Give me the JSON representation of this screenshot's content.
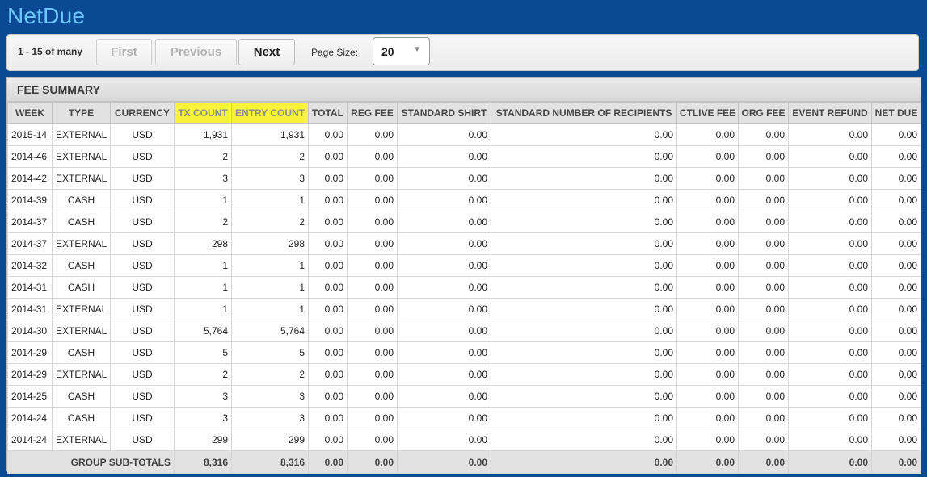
{
  "app": {
    "title": "NetDue"
  },
  "pager": {
    "range_label": "1 - 15 of many",
    "first_label": "First",
    "previous_label": "Previous",
    "next_label": "Next",
    "page_size_label": "Page Size:",
    "page_size_value": "20"
  },
  "panel": {
    "title": "FEE SUMMARY"
  },
  "table": {
    "headers": [
      "WEEK",
      "TYPE",
      "CURRENCY",
      "TX COUNT",
      "ENTRY COUNT",
      "TOTAL",
      "REG FEE",
      "STANDARD SHIRT",
      "STANDARD NUMBER OF RECIPIENTS",
      "CTLIVE FEE",
      "ORG FEE",
      "EVENT REFUND",
      "NET DUE"
    ],
    "highlighted_columns": [
      "TX COUNT",
      "ENTRY COUNT"
    ],
    "highlight_color": "#f6f33a",
    "rows": [
      [
        "2015-14",
        "EXTERNAL",
        "USD",
        "1,931",
        "1,931",
        "0.00",
        "0.00",
        "0.00",
        "0.00",
        "0.00",
        "0.00",
        "0.00",
        "0.00"
      ],
      [
        "2014-46",
        "EXTERNAL",
        "USD",
        "2",
        "2",
        "0.00",
        "0.00",
        "0.00",
        "0.00",
        "0.00",
        "0.00",
        "0.00",
        "0.00"
      ],
      [
        "2014-42",
        "EXTERNAL",
        "USD",
        "3",
        "3",
        "0.00",
        "0.00",
        "0.00",
        "0.00",
        "0.00",
        "0.00",
        "0.00",
        "0.00"
      ],
      [
        "2014-39",
        "CASH",
        "USD",
        "1",
        "1",
        "0.00",
        "0.00",
        "0.00",
        "0.00",
        "0.00",
        "0.00",
        "0.00",
        "0.00"
      ],
      [
        "2014-37",
        "CASH",
        "USD",
        "2",
        "2",
        "0.00",
        "0.00",
        "0.00",
        "0.00",
        "0.00",
        "0.00",
        "0.00",
        "0.00"
      ],
      [
        "2014-37",
        "EXTERNAL",
        "USD",
        "298",
        "298",
        "0.00",
        "0.00",
        "0.00",
        "0.00",
        "0.00",
        "0.00",
        "0.00",
        "0.00"
      ],
      [
        "2014-32",
        "CASH",
        "USD",
        "1",
        "1",
        "0.00",
        "0.00",
        "0.00",
        "0.00",
        "0.00",
        "0.00",
        "0.00",
        "0.00"
      ],
      [
        "2014-31",
        "CASH",
        "USD",
        "1",
        "1",
        "0.00",
        "0.00",
        "0.00",
        "0.00",
        "0.00",
        "0.00",
        "0.00",
        "0.00"
      ],
      [
        "2014-31",
        "EXTERNAL",
        "USD",
        "1",
        "1",
        "0.00",
        "0.00",
        "0.00",
        "0.00",
        "0.00",
        "0.00",
        "0.00",
        "0.00"
      ],
      [
        "2014-30",
        "EXTERNAL",
        "USD",
        "5,764",
        "5,764",
        "0.00",
        "0.00",
        "0.00",
        "0.00",
        "0.00",
        "0.00",
        "0.00",
        "0.00"
      ],
      [
        "2014-29",
        "CASH",
        "USD",
        "5",
        "5",
        "0.00",
        "0.00",
        "0.00",
        "0.00",
        "0.00",
        "0.00",
        "0.00",
        "0.00"
      ],
      [
        "2014-29",
        "EXTERNAL",
        "USD",
        "2",
        "2",
        "0.00",
        "0.00",
        "0.00",
        "0.00",
        "0.00",
        "0.00",
        "0.00",
        "0.00"
      ],
      [
        "2014-25",
        "CASH",
        "USD",
        "3",
        "3",
        "0.00",
        "0.00",
        "0.00",
        "0.00",
        "0.00",
        "0.00",
        "0.00",
        "0.00"
      ],
      [
        "2014-24",
        "CASH",
        "USD",
        "3",
        "3",
        "0.00",
        "0.00",
        "0.00",
        "0.00",
        "0.00",
        "0.00",
        "0.00",
        "0.00"
      ],
      [
        "2014-24",
        "EXTERNAL",
        "USD",
        "299",
        "299",
        "0.00",
        "0.00",
        "0.00",
        "0.00",
        "0.00",
        "0.00",
        "0.00",
        "0.00"
      ]
    ],
    "totals": {
      "label": "GROUP SUB-TOTALS",
      "values": [
        "8,316",
        "8,316",
        "0.00",
        "0.00",
        "0.00",
        "0.00",
        "0.00",
        "0.00",
        "0.00",
        "0.00"
      ]
    }
  }
}
